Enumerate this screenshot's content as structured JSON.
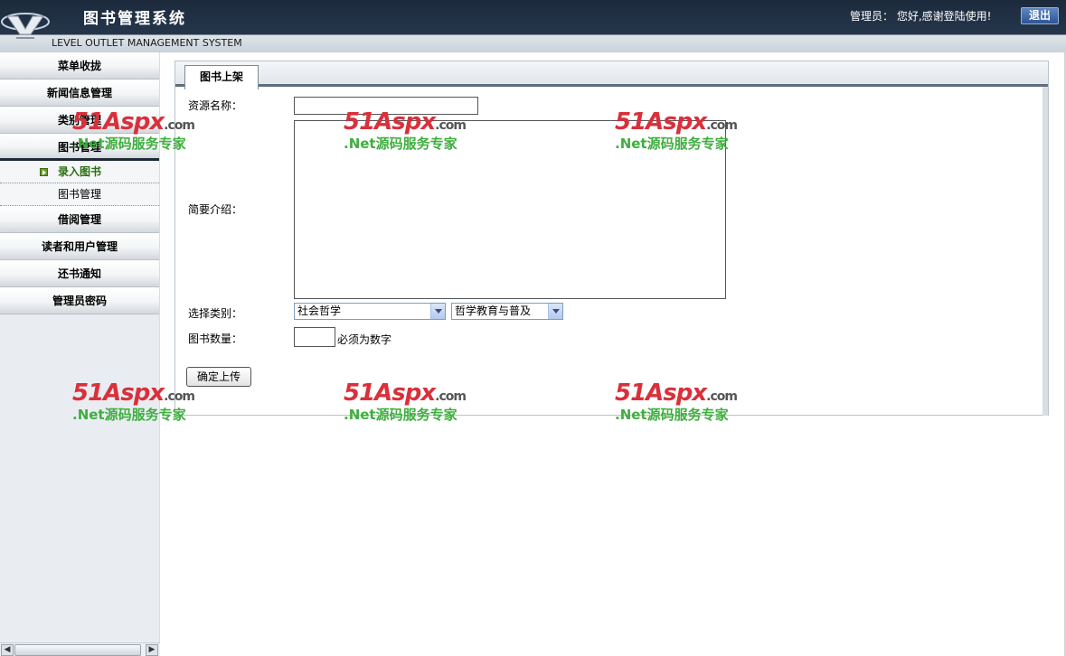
{
  "header": {
    "title": "图书管理系统",
    "subtitle": "LEVEL OUTLET MANAGEMENT SYSTEM",
    "welcome": "管理员： 您好,感谢登陆使用!",
    "logout_label": "退出"
  },
  "sidebar": {
    "items": [
      {
        "label": "菜单收拢"
      },
      {
        "label": "新闻信息管理"
      },
      {
        "label": "类别管理"
      },
      {
        "label": "图书管理"
      }
    ],
    "sub_items": [
      {
        "label": "录入图书"
      },
      {
        "label": "图书管理"
      }
    ],
    "items_after": [
      {
        "label": "借阅管理"
      },
      {
        "label": "读者和用户管理"
      },
      {
        "label": "还书通知"
      },
      {
        "label": "管理员密码"
      }
    ]
  },
  "main": {
    "tab_label": "图书上架",
    "form": {
      "name_label": "资源名称：",
      "name_value": "",
      "intro_label": "简要介绍：",
      "intro_value": "",
      "category_label": "选择类别：",
      "category_primary": "社会哲学",
      "category_secondary": "哲学教育与普及",
      "quantity_label": "图书数量：",
      "quantity_value": "",
      "quantity_hint": "必须为数字",
      "submit_label": "确定上传"
    }
  },
  "watermark": {
    "brand": "51Aspx",
    "domain": ".com",
    "slogan": ".Net源码服务专家"
  }
}
